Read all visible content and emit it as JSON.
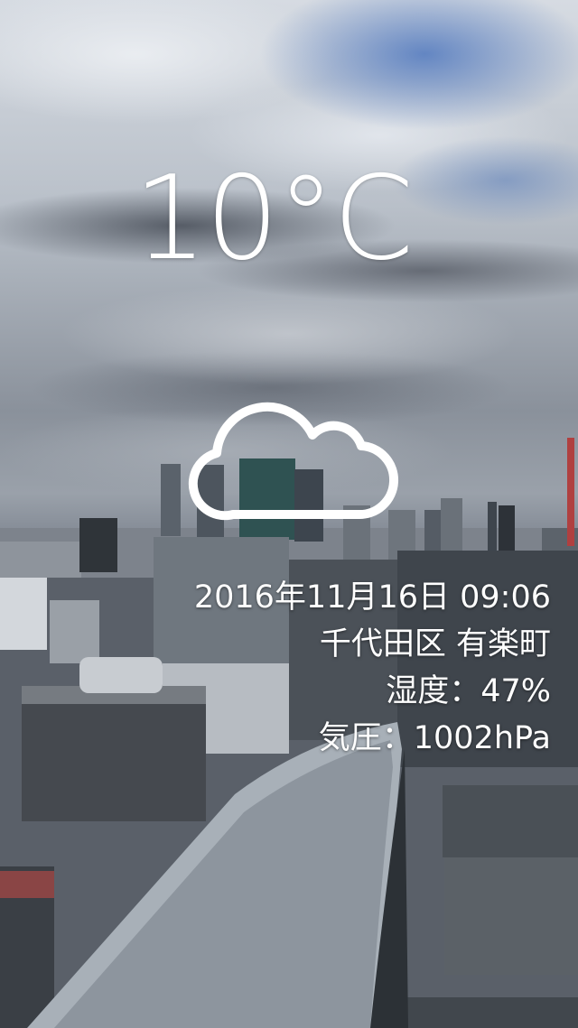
{
  "weather": {
    "temperature": "10°C",
    "condition_icon": "cloud-icon",
    "datetime": "2016年11月16日 09:06",
    "location": "千代田区 有楽町",
    "humidity": "湿度：47%",
    "pressure": "気圧：1002hPa"
  },
  "colors": {
    "text": "#ffffff"
  }
}
